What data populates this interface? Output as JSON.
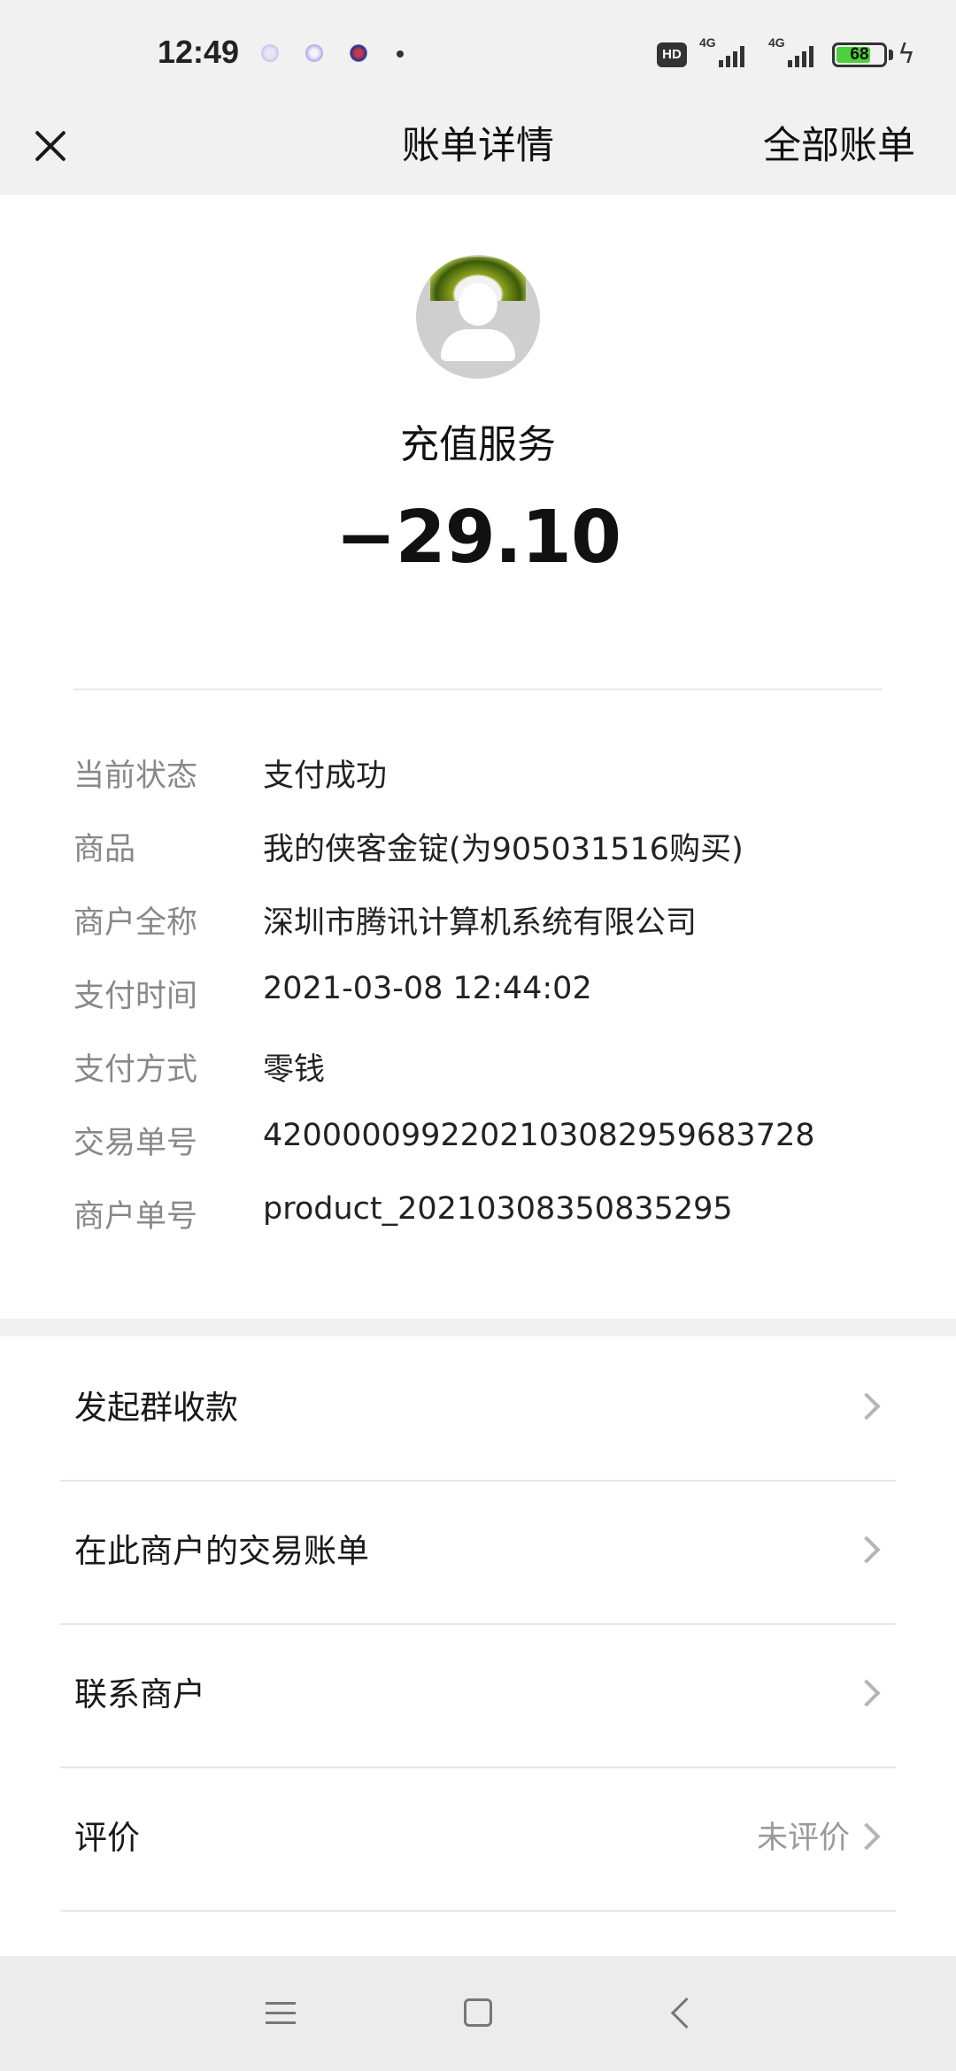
{
  "status_bar": {
    "time": "12:49",
    "network_1": "4G",
    "network_2": "4G",
    "hd": "HD",
    "battery": "68"
  },
  "nav": {
    "title": "账单详情",
    "right_action": "全部账单"
  },
  "bill": {
    "merchant": "充值服务",
    "amount": "−29.10",
    "details": [
      {
        "label": "当前状态",
        "value": "支付成功"
      },
      {
        "label": "商品",
        "value": "我的侠客金锭(为905031516购买)"
      },
      {
        "label": "商户全称",
        "value": "深圳市腾讯计算机系统有限公司"
      },
      {
        "label": "支付时间",
        "value": "2021-03-08 12:44:02"
      },
      {
        "label": "支付方式",
        "value": "零钱"
      },
      {
        "label": "交易单号",
        "value": "4200000992202103082959683728"
      },
      {
        "label": "商户单号",
        "value": "product_20210308350835295"
      }
    ]
  },
  "actions": [
    {
      "label": "发起群收款",
      "value": ""
    },
    {
      "label": "在此商户的交易账单",
      "value": ""
    },
    {
      "label": "联系商户",
      "value": ""
    },
    {
      "label": "评价",
      "value": "未评价"
    }
  ]
}
